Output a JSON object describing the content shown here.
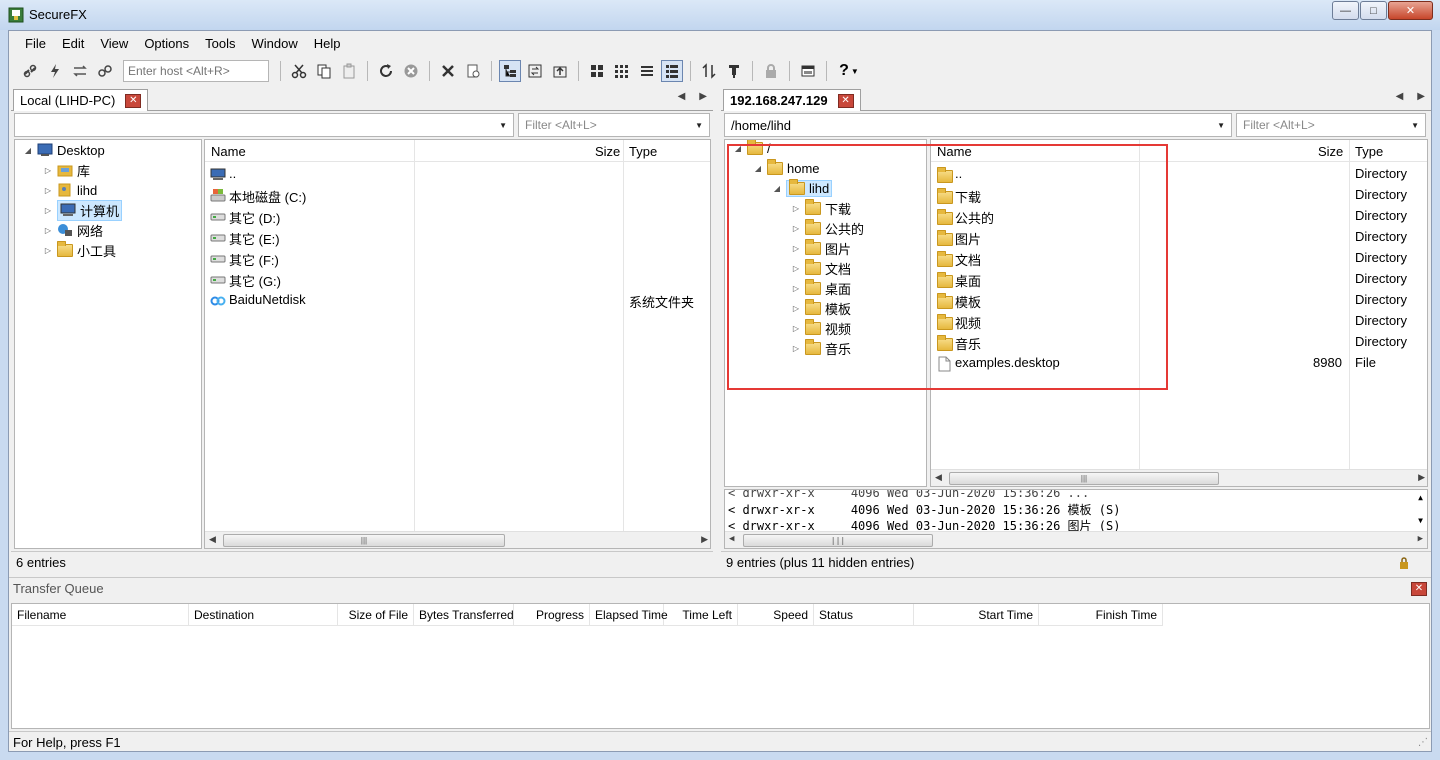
{
  "window": {
    "title": "SecureFX",
    "minimize": "—",
    "maximize": "□",
    "close": "✕"
  },
  "menu": [
    "File",
    "Edit",
    "View",
    "Options",
    "Tools",
    "Window",
    "Help"
  ],
  "toolbar": {
    "host_placeholder": "Enter host <Alt+R>",
    "icons": [
      "connect-icon",
      "quick-connect-icon",
      "reconnect-icon",
      "disconnect-icon",
      "cut-icon",
      "copy-icon",
      "paste-icon",
      "refresh-icon",
      "stop-icon",
      "delete-icon",
      "properties-icon",
      "tree-view-icon",
      "synchronize-icon",
      "parent-dir-icon",
      "large-icons-icon",
      "small-icons-icon",
      "list-view-icon",
      "details-view-icon",
      "transfer-icon",
      "filter-icon",
      "lock-icon",
      "session-icon",
      "help-icon"
    ]
  },
  "local": {
    "tab_label": "Local (LIHD-PC)",
    "path": "",
    "filter_placeholder": "Filter <Alt+L>",
    "tree": [
      {
        "label": "Desktop",
        "expanded": true,
        "level": 0
      },
      {
        "label": "库",
        "level": 1
      },
      {
        "label": "lihd",
        "level": 1
      },
      {
        "label": "计算机",
        "level": 1,
        "selected": true
      },
      {
        "label": "网络",
        "level": 1
      },
      {
        "label": "小工具",
        "level": 1
      }
    ],
    "columns": {
      "name": "Name",
      "size": "Size",
      "type": "Type"
    },
    "files": [
      {
        "name": "..",
        "size": "",
        "type": ""
      },
      {
        "name": "本地磁盘 (C:)",
        "size": "",
        "type": ""
      },
      {
        "name": "其它 (D:)",
        "size": "",
        "type": ""
      },
      {
        "name": "其它 (E:)",
        "size": "",
        "type": ""
      },
      {
        "name": "其它 (F:)",
        "size": "",
        "type": ""
      },
      {
        "name": "其它 (G:)",
        "size": "",
        "type": ""
      },
      {
        "name": "BaiduNetdisk",
        "size": "",
        "type": "系统文件夹"
      }
    ],
    "status": "6 entries"
  },
  "remote": {
    "tab_label": "192.168.247.129",
    "path": "/home/lihd",
    "filter_placeholder": "Filter <Alt+L>",
    "tree": [
      {
        "label": "/",
        "level": 0
      },
      {
        "label": "home",
        "level": 1
      },
      {
        "label": "lihd",
        "level": 2,
        "selected": true
      },
      {
        "label": "下载",
        "level": 3
      },
      {
        "label": "公共的",
        "level": 3
      },
      {
        "label": "图片",
        "level": 3
      },
      {
        "label": "文档",
        "level": 3
      },
      {
        "label": "桌面",
        "level": 3
      },
      {
        "label": "模板",
        "level": 3
      },
      {
        "label": "视频",
        "level": 3
      },
      {
        "label": "音乐",
        "level": 3
      }
    ],
    "columns": {
      "name": "Name",
      "size": "Size",
      "type": "Type"
    },
    "files": [
      {
        "name": "..",
        "size": "",
        "type": "Directory"
      },
      {
        "name": "下载",
        "size": "",
        "type": "Directory"
      },
      {
        "name": "公共的",
        "size": "",
        "type": "Directory"
      },
      {
        "name": "图片",
        "size": "",
        "type": "Directory"
      },
      {
        "name": "文档",
        "size": "",
        "type": "Directory"
      },
      {
        "name": "桌面",
        "size": "",
        "type": "Directory"
      },
      {
        "name": "模板",
        "size": "",
        "type": "Directory"
      },
      {
        "name": "视频",
        "size": "",
        "type": "Directory"
      },
      {
        "name": "音乐",
        "size": "",
        "type": "Directory"
      },
      {
        "name": "examples.desktop",
        "size": "8980",
        "type": "File"
      }
    ],
    "log": [
      "< drwxr-xr-x     4096 Wed 03-Jun-2020 15:36:26 模板 (S)",
      "< drwxr-xr-x     4096 Wed 03-Jun-2020 15:36:26 图片 (S)"
    ],
    "status": "9 entries (plus 11 hidden entries)"
  },
  "queue": {
    "title": "Transfer Queue",
    "columns": [
      "Filename",
      "Destination",
      "Size of File",
      "Bytes Transferred",
      "Progress",
      "Elapsed Time",
      "Time Left",
      "Speed",
      "Status",
      "Start Time",
      "Finish Time"
    ]
  },
  "statusbar": {
    "help": "For Help, press F1"
  },
  "colors": {
    "highlight": "#e53935",
    "selection": "#cde8ff",
    "folder": "#e6b83e"
  }
}
